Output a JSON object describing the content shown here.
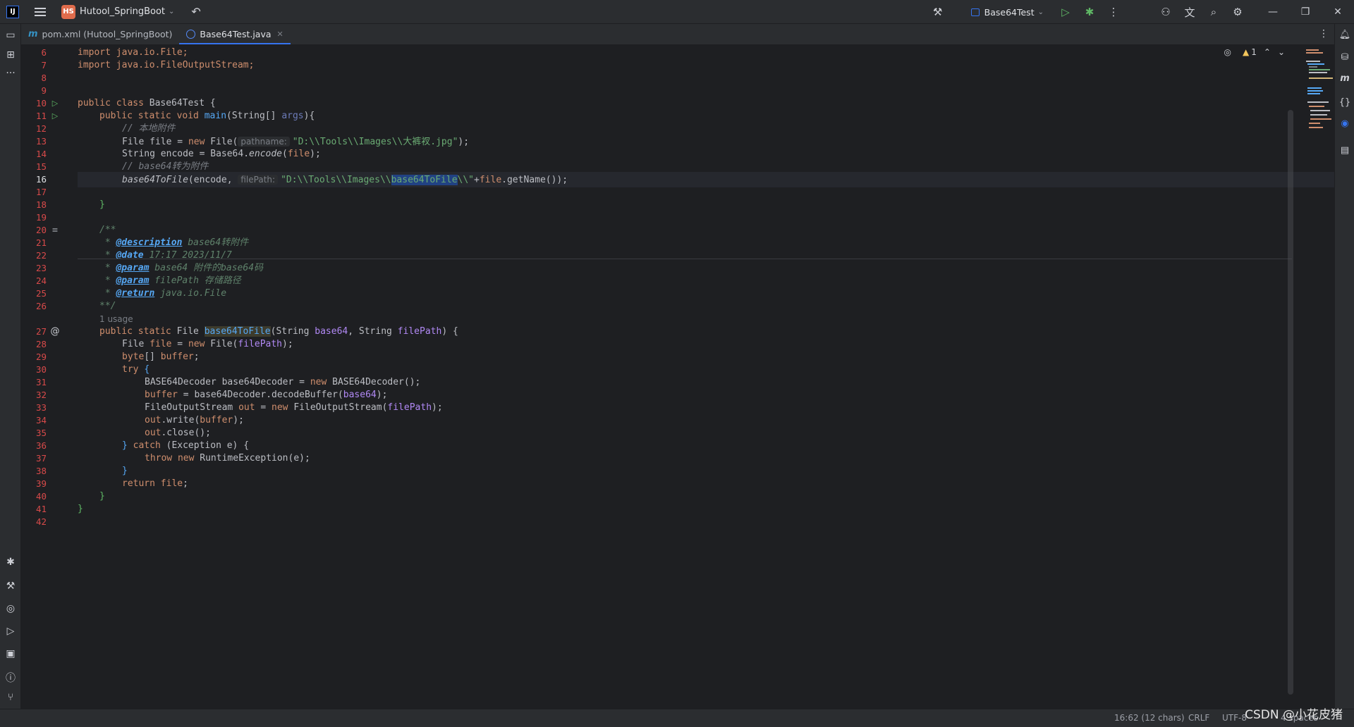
{
  "titlebar": {
    "project_badge": "HS",
    "project_name": "Hutool_SpringBoot",
    "run_config": "Base64Test"
  },
  "tabs": [
    {
      "label": "pom.xml (Hutool_SpringBoot)",
      "icon": "maven-icon"
    },
    {
      "label": "Base64Test.java",
      "icon": "java-class-icon"
    }
  ],
  "inspection": {
    "warnings": "1"
  },
  "code": {
    "lines": [
      {
        "n": "6"
      },
      {
        "n": "7"
      },
      {
        "n": "8"
      },
      {
        "n": "9"
      },
      {
        "n": "10"
      },
      {
        "n": "11"
      },
      {
        "n": "12"
      },
      {
        "n": "13"
      },
      {
        "n": "14"
      },
      {
        "n": "15"
      },
      {
        "n": "16"
      },
      {
        "n": "17"
      },
      {
        "n": "18"
      },
      {
        "n": "19"
      },
      {
        "n": "20"
      },
      {
        "n": "21"
      },
      {
        "n": "22"
      },
      {
        "n": "23"
      },
      {
        "n": "24"
      },
      {
        "n": "25"
      },
      {
        "n": "26"
      },
      {
        "n": "27"
      },
      {
        "n": "28"
      },
      {
        "n": "29"
      },
      {
        "n": "30"
      },
      {
        "n": "31"
      },
      {
        "n": "32"
      },
      {
        "n": "33"
      },
      {
        "n": "34"
      },
      {
        "n": "35"
      },
      {
        "n": "36"
      },
      {
        "n": "37"
      },
      {
        "n": "38"
      },
      {
        "n": "39"
      },
      {
        "n": "40"
      },
      {
        "n": "41"
      },
      {
        "n": "42"
      }
    ],
    "l6": "import java.io.File;",
    "l7": "import java.io.FileOutputStream;",
    "l10_kw": "public class ",
    "l10_name": "Base64Test {",
    "l11_kw": "public static void ",
    "l11_fn": "main",
    "l11_a": "(String[] ",
    "l11_p": "args",
    "l11_b": "){",
    "l12": "// 本地附件",
    "l13_a": "File ",
    "l13_v": "file",
    "l13_b": " = ",
    "l13_new": "new ",
    "l13_c": "File(",
    "l13_hint": "pathname:",
    "l13_str": "\"D:\\\\Tools\\\\Images\\\\大裤衩.jpg\"",
    "l13_end": ");",
    "l14_a": "String ",
    "l14_v": "encode",
    "l14_b": " = Base64.",
    "l14_m": "encode",
    "l14_c": "(",
    "l14_p": "file",
    "l14_end": ");",
    "l15": "// base64转为附件",
    "l16_m": "base64ToFile",
    "l16_a": "(encode, ",
    "l16_hint": "filePath:",
    "l16_str1": "\"D:\\\\Tools\\\\Images\\\\",
    "l16_sel": "base64ToFile",
    "l16_str2": "\\\\\"",
    "l16_plus": "+",
    "l16_v": "file",
    "l16_end": ".getName());",
    "l18": "}",
    "l20": "/**",
    "l21_s": " * ",
    "l21_tag": "@description",
    "l21_t": " base64转附件",
    "l22_s": " * ",
    "l22_tag": "@date",
    "l22_t": " 17:17 2023/11/7",
    "l23_s": " * ",
    "l23_tag": "@param",
    "l23_t": " base64 附件的base64码",
    "l24_s": " * ",
    "l24_tag": "@param",
    "l24_t": " filePath 存储路径",
    "l25_s": " * ",
    "l25_tag": "@return",
    "l25_t": " java.io.File",
    "l26": "**/",
    "usage": "1 usage",
    "l27_kw": "public static ",
    "l27_a": "File ",
    "l27_fn": "base64ToFile",
    "l27_b": "(String ",
    "l27_p1": "base64",
    "l27_c": ", String ",
    "l27_p2": "filePath",
    "l27_d": ") {",
    "l28_a": "File ",
    "l28_v": "file",
    "l28_b": " = ",
    "l28_new": "new ",
    "l28_c": "File(",
    "l28_p": "filePath",
    "l28_end": ");",
    "l29_kw": "byte",
    "l29_a": "[] ",
    "l29_v": "buffer",
    "l29_end": ";",
    "l30_kw": "try ",
    "l30_a": "{",
    "l31_a": "BASE64Decoder base64Decoder = ",
    "l31_new": "new ",
    "l31_b": "BASE64Decoder();",
    "l32_v": "buffer",
    "l32_a": " = base64Decoder.decodeBuffer(",
    "l32_p": "base64",
    "l32_end": ");",
    "l33_a": "FileOutputStream ",
    "l33_v": "out",
    "l33_b": " = ",
    "l33_new": "new ",
    "l33_c": "FileOutputStream(",
    "l33_p": "filePath",
    "l33_end": ");",
    "l34_v": "out",
    "l34_a": ".write(",
    "l34_p": "buffer",
    "l34_end": ");",
    "l35_v": "out",
    "l35_a": ".close();",
    "l36_a": "} ",
    "l36_kw": "catch ",
    "l36_b": "(Exception e) {",
    "l37_kw": "throw new ",
    "l37_a": "RuntimeException(e);",
    "l38": "}",
    "l39_kw": "return ",
    "l39_v": "file",
    "l39_end": ";",
    "l40": "}",
    "l41": "}"
  },
  "statusbar": {
    "position": "16:62 (12 chars)",
    "line_sep": "CRLF",
    "encoding": "UTF-8",
    "indent": "4 spaces"
  },
  "watermark": "CSDN @小花皮猪"
}
